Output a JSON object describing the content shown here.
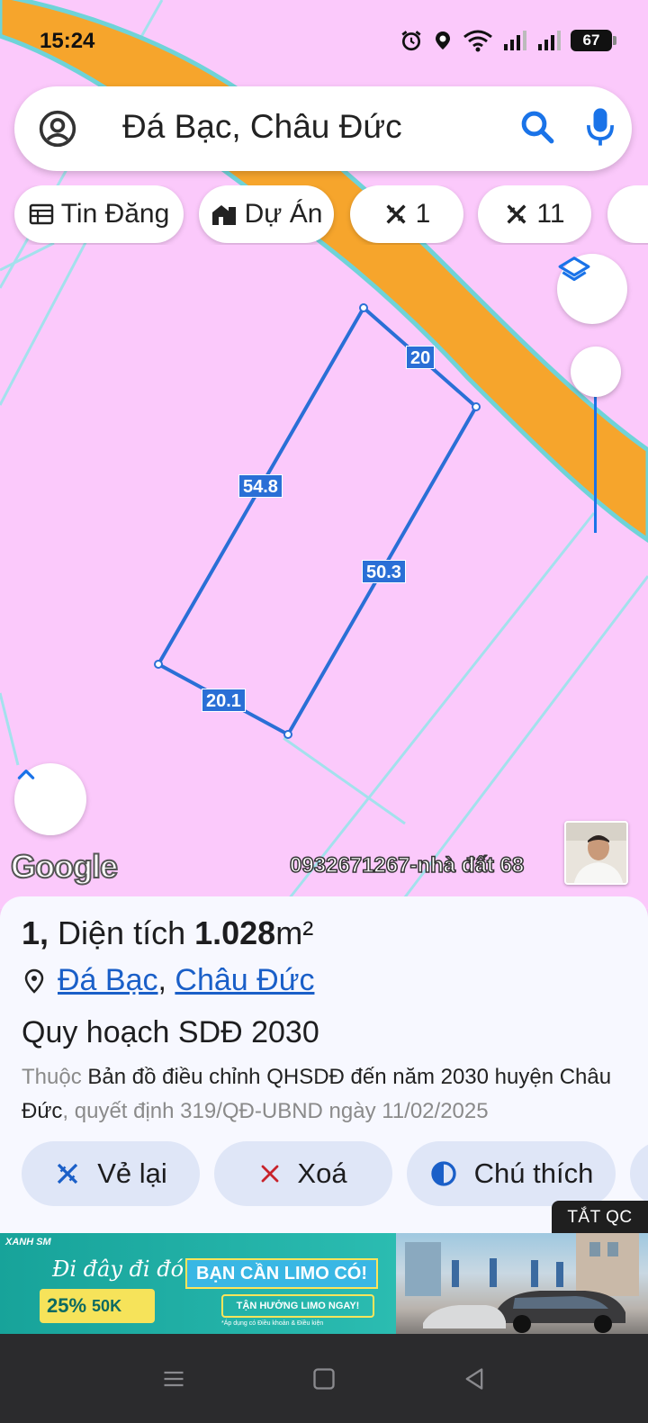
{
  "status": {
    "time": "15:24",
    "battery": "67"
  },
  "search": {
    "query": "Đá Bạc, Châu Đức"
  },
  "chips": [
    {
      "label": "Tin Đăng",
      "icon": "calendar-table-icon"
    },
    {
      "label": "Dự Án",
      "icon": "buildings-icon"
    },
    {
      "label": "1",
      "icon": "ruler-pencil-icon"
    },
    {
      "label": "11",
      "icon": "ruler-pencil-icon"
    }
  ],
  "map": {
    "edge_labels": [
      "20",
      "54.8",
      "50.3",
      "20.1"
    ],
    "attribution": "Google",
    "watermark": "0932671267-nhà đất 68",
    "colors": {
      "land": "#fbc9fb",
      "road": "#f6a52c",
      "plot": "#2a6fd6"
    }
  },
  "sheet": {
    "title_prefix": "1,",
    "title_text": " Diện tích ",
    "area_value": "1.028",
    "area_unit": "m²",
    "location_1": "Đá Bạc",
    "location_sep": ",",
    "location_2": "Châu Đức",
    "plan_title": "Quy hoạch SDĐ 2030",
    "desc_muted_1": "Thuộc ",
    "desc_main": "Bản đồ điều chỉnh QHSDĐ đến năm 2030 huyện Châu Đức",
    "desc_muted_2": ", quyết định 319/QĐ-UBND ngày 11/02/2025"
  },
  "actions": [
    {
      "label": "Vẻ lại",
      "icon": "ruler-pencil-icon"
    },
    {
      "label": "Xoá",
      "icon": "close-icon"
    },
    {
      "label": "Chú thích",
      "icon": "contrast-icon"
    }
  ],
  "ad": {
    "off_label": "TẮT QC",
    "brand": "XANH SM",
    "script": "Đi đây đi đó",
    "headline": "BẠN CẦN LIMO CÓ!",
    "promo_percent": "25%",
    "promo_amount": "50K",
    "cta": "TẬN HƯỞNG LIMO NGAY!",
    "fine_print": "*Áp dụng có Điều khoản & Điều kiện"
  }
}
